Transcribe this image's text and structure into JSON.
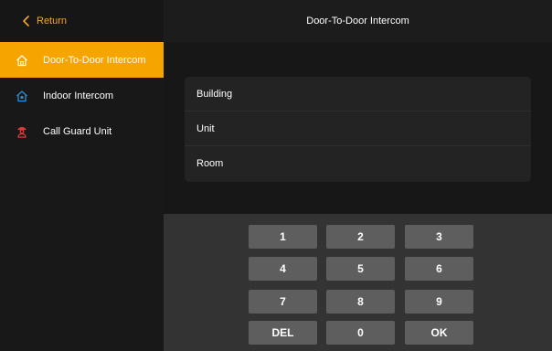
{
  "return_label": "Return",
  "header": {
    "title": "Door-To-Door Intercom"
  },
  "nav": {
    "items": [
      {
        "label": "Door-To-Door Intercom",
        "icon": "home-icon",
        "active": true
      },
      {
        "label": "Indoor Intercom",
        "icon": "indoor-home-icon",
        "active": false
      },
      {
        "label": "Call Guard Unit",
        "icon": "guard-icon",
        "active": false
      }
    ]
  },
  "form": {
    "fields": [
      "Building",
      "Unit",
      "Room"
    ]
  },
  "keypad": {
    "keys": [
      "1",
      "2",
      "3",
      "4",
      "5",
      "6",
      "7",
      "8",
      "9",
      "DEL",
      "0",
      "OK"
    ]
  },
  "colors": {
    "accent": "#f5a400",
    "return_text": "#f6a623",
    "indoor_icon": "#2a8fd8",
    "guard_icon": "#e03b3b",
    "key_bg": "#5e5e5e"
  }
}
